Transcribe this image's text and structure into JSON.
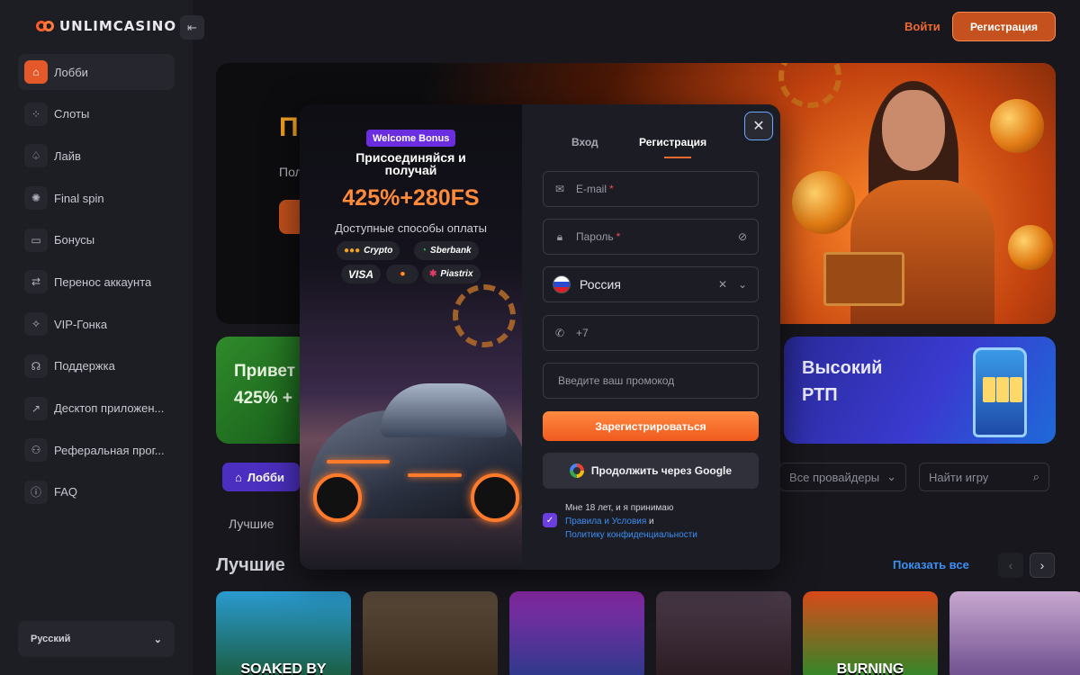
{
  "header": {
    "logo_text": "UNLIMCASINO",
    "login_label": "Войти",
    "register_label": "Регистрация"
  },
  "sidebar": {
    "items": [
      {
        "label": "Лобби",
        "icon": "home-icon",
        "glyph": "⌂",
        "active": true
      },
      {
        "label": "Слоты",
        "icon": "grid-icon",
        "glyph": "⁘",
        "active": false
      },
      {
        "label": "Лайв",
        "icon": "spade-icon",
        "glyph": "♤",
        "active": false
      },
      {
        "label": "Final spin",
        "icon": "wheel-icon",
        "glyph": "✺",
        "active": false
      },
      {
        "label": "Бонусы",
        "icon": "ticket-icon",
        "glyph": "▭",
        "active": false
      },
      {
        "label": "Перенос аккаунта",
        "icon": "transfer-icon",
        "glyph": "⇄",
        "active": false
      },
      {
        "label": "VIP-Гонка",
        "icon": "sparkle-icon",
        "glyph": "✧",
        "active": false
      },
      {
        "label": "Поддержка",
        "icon": "headset-icon",
        "glyph": "☊",
        "active": false
      },
      {
        "label": "Десктоп приложен...",
        "icon": "external-icon",
        "glyph": "↗",
        "active": false
      },
      {
        "label": "Реферальная прог...",
        "icon": "users-icon",
        "glyph": "⚇",
        "active": false
      },
      {
        "label": "FAQ",
        "icon": "info-icon",
        "glyph": "ⓘ",
        "active": false
      }
    ],
    "language": "Русский"
  },
  "hero": {
    "title_fragment": "П",
    "subtitle_fragment": "Пол"
  },
  "promos": {
    "green_line1": "Привет",
    "green_line2": "425% +",
    "blue_line1": "Высокий",
    "blue_line2": "РТП"
  },
  "filters": {
    "lobby_tab": "Лобби",
    "providers": "Все провайдеры",
    "search_placeholder": "Найти игру",
    "best_tab": "Лучшие"
  },
  "section": {
    "title": "Лучшие",
    "show_all": "Показать все"
  },
  "games": [
    {
      "text": "SOAKED BY",
      "bg": "linear-gradient(#2a9ad0,#1a5a3a)"
    },
    {
      "text": "",
      "bg": "linear-gradient(#5a4a3a,#3a2a1a)"
    },
    {
      "text": "",
      "bg": "linear-gradient(#8a2aa8,#2a3a8a)"
    },
    {
      "text": "",
      "bg": "linear-gradient(#4a3a4a,#2a1a20)"
    },
    {
      "text": "BURNING",
      "bg": "linear-gradient(#d84a1a,#2a8a2a)"
    },
    {
      "text": "",
      "bg": "linear-gradient(#c8a8d0,#6a4a8a)"
    }
  ],
  "modal": {
    "welcome_badge": "Welcome Bonus",
    "join_line1": "Присоединяйся и",
    "join_line2": "получай",
    "bonus_amount": "425%+280FS",
    "payments_title": "Доступные способы оплаты",
    "payments": {
      "crypto": "Crypto",
      "sberbank": "Sberbank",
      "visa": "VISA",
      "piastrix": "Piastrix"
    },
    "tab_login": "Вход",
    "tab_register": "Регистрация",
    "email_placeholder": "E-mail",
    "password_placeholder": "Пароль",
    "required_mark": "*",
    "country": "Россия",
    "phone_prefix": "+7",
    "promo_placeholder": "Введите ваш промокод",
    "submit": "Зарегистрироваться",
    "google": "Продолжить через Google",
    "terms_line1": "Мне 18 лет, и я принимаю",
    "terms_link1": "Правила и Условия",
    "terms_and": " и",
    "terms_link2": "Политику конфиденциальности"
  },
  "colors": {
    "accent_orange": "#f06a32",
    "accent_purple": "#4b2fc0",
    "link_blue": "#3c8ef0"
  }
}
